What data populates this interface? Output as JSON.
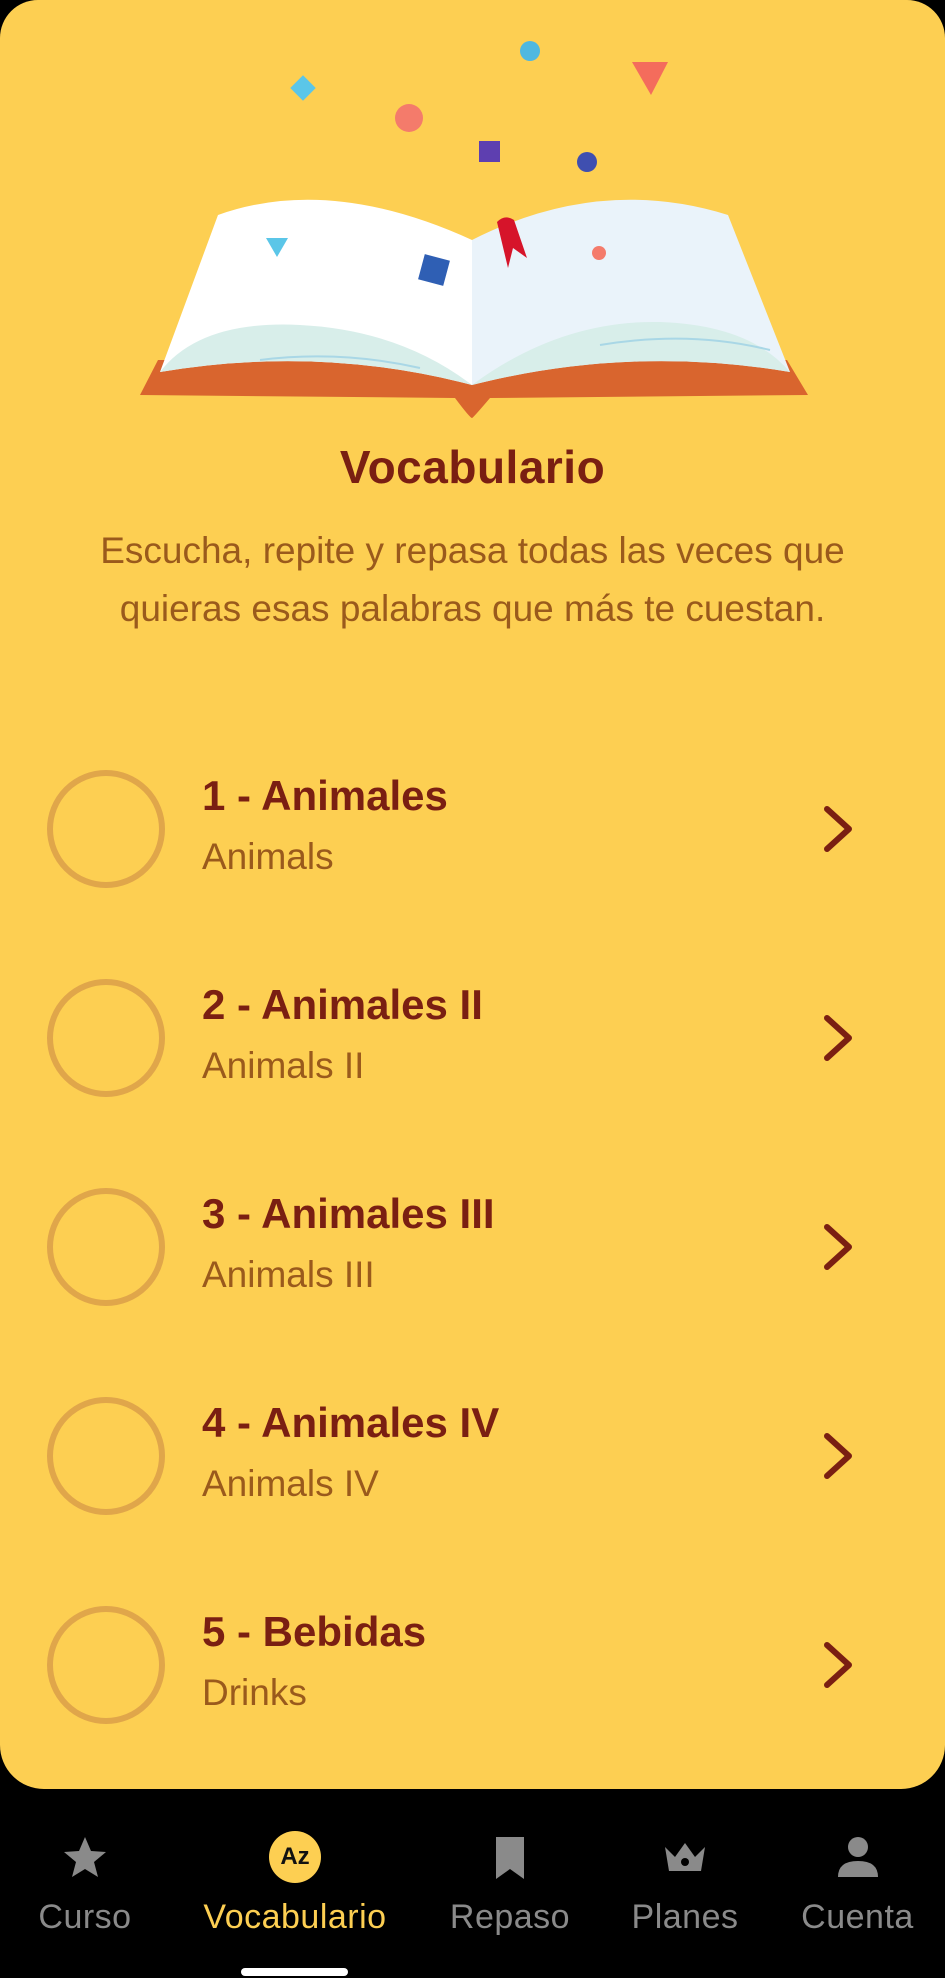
{
  "header": {
    "title": "Vocabulario",
    "description": "Escucha, repite y repasa todas las veces que quieras esas palabras que más te cuestan."
  },
  "lessons": [
    {
      "title": "1 - Animales",
      "subtitle": "Animals"
    },
    {
      "title": "2 - Animales II",
      "subtitle": "Animals II"
    },
    {
      "title": "3 - Animales III",
      "subtitle": "Animals III"
    },
    {
      "title": "4 - Animales IV",
      "subtitle": "Animals IV"
    },
    {
      "title": "5 - Bebidas",
      "subtitle": "Drinks"
    }
  ],
  "tabs": [
    {
      "label": "Curso",
      "icon": "star-icon"
    },
    {
      "label": "Vocabulario",
      "icon": "az-icon",
      "badge": "Az",
      "active": true
    },
    {
      "label": "Repaso",
      "icon": "bookmark-icon"
    },
    {
      "label": "Planes",
      "icon": "crown-icon"
    },
    {
      "label": "Cuenta",
      "icon": "person-icon"
    }
  ],
  "colors": {
    "background": "#FDCF52",
    "title": "#7A1F12",
    "subtitle": "#9A5A1C",
    "circle": "#E0A64A",
    "tab_active": "#FDCF52",
    "tab_inactive": "#8A8A8A"
  }
}
